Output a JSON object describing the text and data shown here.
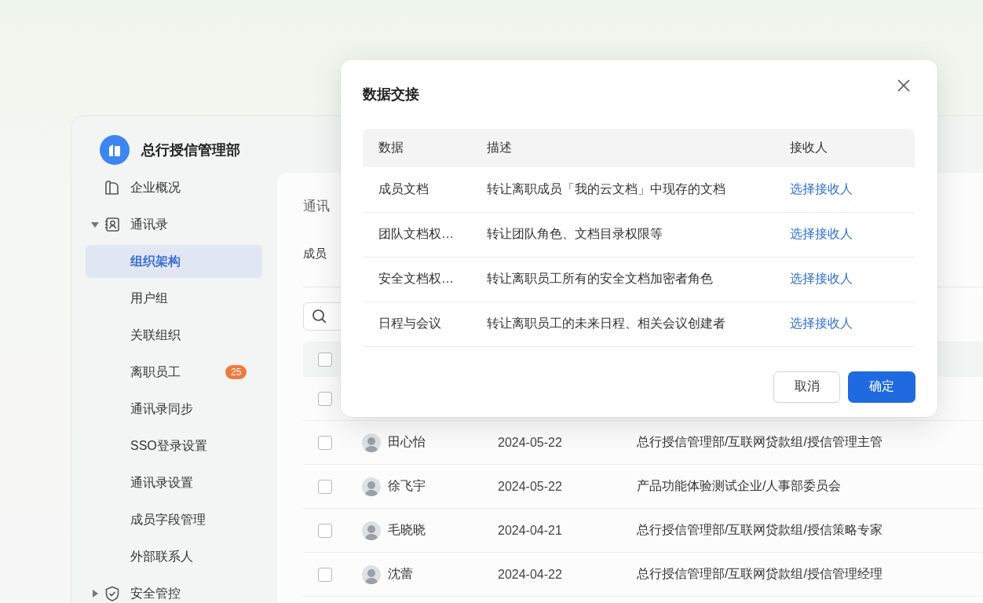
{
  "app": {
    "title": "总行授信管理部"
  },
  "sidebar": {
    "items": [
      {
        "label": "企业概况",
        "selected": false
      },
      {
        "label": "通讯录",
        "selected": false,
        "expanded": true,
        "children": [
          {
            "label": "组织架构",
            "selected": true
          },
          {
            "label": "用户组",
            "selected": false
          },
          {
            "label": "关联组织",
            "selected": false
          },
          {
            "label": "离职员工",
            "selected": false,
            "badge": "25"
          },
          {
            "label": "通讯录同步",
            "selected": false
          },
          {
            "label": "SSO登录设置",
            "selected": false
          },
          {
            "label": "通讯录设置",
            "selected": false
          },
          {
            "label": "成员字段管理",
            "selected": false
          },
          {
            "label": "外部联系人",
            "selected": false
          }
        ]
      },
      {
        "label": "安全管控",
        "selected": false,
        "expanded": false
      }
    ]
  },
  "content": {
    "breadcrumb": "通讯",
    "tab": "成员",
    "header_checked": false,
    "rows": [
      {
        "checked": false
      },
      {
        "checked": false,
        "name": "田心怡",
        "date": "2024-05-22",
        "department": "总行授信管理部/互联网贷款组/授信管理主管"
      },
      {
        "checked": false,
        "name": "徐飞宇",
        "date": "2024-05-22",
        "department": "产品功能体验测试企业/人事部委员会"
      },
      {
        "checked": false,
        "name": "毛晓晓",
        "date": "2024-04-21",
        "department": "总行授信管理部/互联网贷款组/授信策略专家"
      },
      {
        "checked": false,
        "name": "沈蕾",
        "date": "2024-04-22",
        "department": "总行授信管理部/互联网贷款组/授信管理经理"
      }
    ]
  },
  "dialog": {
    "title": "数据交接",
    "columns": [
      "数据",
      "描述",
      "接收人"
    ],
    "rows": [
      {
        "data": "成员文档",
        "description": "转让离职成员「我的云文档」中现存的文档",
        "receiver": "选择接收人"
      },
      {
        "data": "团队文档权…",
        "description": "转让团队角色、文档目录权限等",
        "receiver": "选择接收人"
      },
      {
        "data": "安全文档权…",
        "description": "转让离职员工所有的安全文档加密者角色",
        "receiver": "选择接收人"
      },
      {
        "data": "日程与会议",
        "description": "转让离职员工的未来日程、相关会议创建者",
        "receiver": "选择接收人"
      }
    ],
    "buttons": [
      {
        "label": "取消",
        "kind": "secondary"
      },
      {
        "label": "确定",
        "kind": "primary"
      }
    ]
  }
}
